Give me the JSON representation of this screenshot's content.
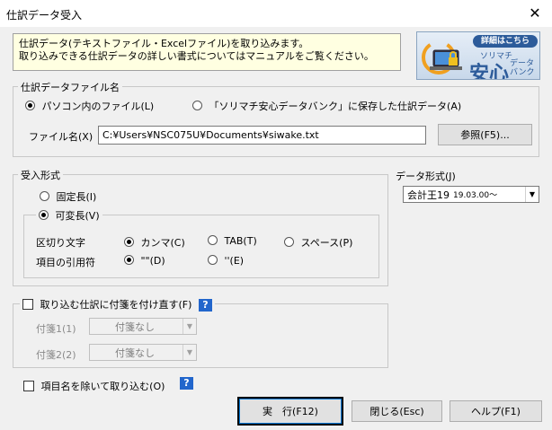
{
  "window": {
    "title": "仕訳データ受入",
    "close_glyph": "✕"
  },
  "info": {
    "line1": "仕訳データ(テキストファイル・Excelファイル)を取り込みます。",
    "line2": "取り込みできる仕訳データの詳しい書式についてはマニュアルをご覧ください。"
  },
  "banner": {
    "tag": "詳細はこちら",
    "sub": "ソリマチ",
    "main": "安心",
    "side1": "データ",
    "side2": "バンク"
  },
  "file_group": {
    "label": "仕訳データファイル名",
    "radio_pc": "パソコン内のファイル(L)",
    "radio_bank": "「ソリマチ安心データバンク」に保存した仕訳データ(A)",
    "filename_label": "ファイル名(X)",
    "filename_value": "C:¥Users¥NSC075U¥Documents¥siwake.txt",
    "browse_label": "参照(F5)..."
  },
  "format_group": {
    "label": "受入形式",
    "fixed": "固定長(I)",
    "variable": "可変長(V)",
    "delimiter_label": "区切り文字",
    "comma": "カンマ(C)",
    "tab": "TAB(T)",
    "space": "スペース(P)",
    "quote_label": "項目の引用符",
    "dquote": "\"\"(D)",
    "squote": "''(E)"
  },
  "data_format": {
    "label": "データ形式(J)",
    "value": "会計王19",
    "version": "19.03.00～"
  },
  "tag_group": {
    "label": "取り込む仕訳に付箋を付け直す(F)",
    "tag1_label": "付箋1(1)",
    "tag1_value": "付箋なし",
    "tag2_label": "付箋2(2)",
    "tag2_value": "付箋なし"
  },
  "exclude_names": {
    "label": "項目名を除いて取り込む(O)"
  },
  "help_glyph": "?",
  "buttons": {
    "run": "実　行(F12)",
    "close": "閉じる(Esc)",
    "help": "ヘルプ(F1)"
  },
  "colors": {
    "info_bg": "#ffffe1",
    "banner_blue": "#2c5b9a",
    "help_blue": "#2266cc"
  }
}
